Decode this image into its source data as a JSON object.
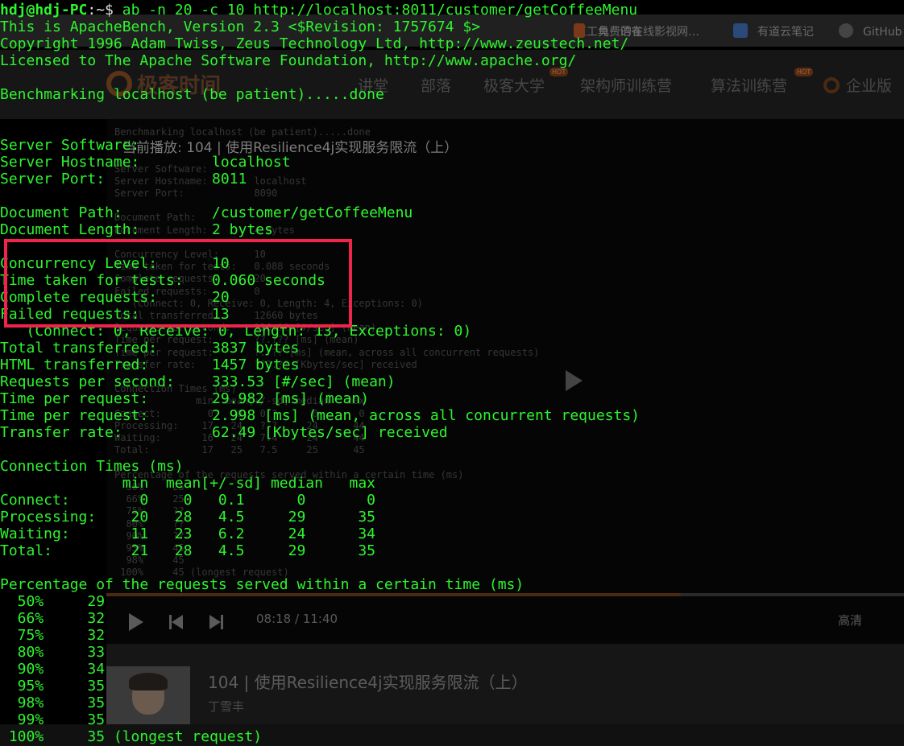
{
  "terminal": {
    "prompt": {
      "user_host": "hdj@hdj-PC",
      "path": ":~$ ",
      "command": "ab -n 20 -c 10 http://localhost:8011/customer/getCoffeeMenu"
    },
    "banner": [
      "This is ApacheBench, Version 2.3 <$Revision: 1757674 $>",
      "Copyright 1996 Adam Twiss, Zeus Technology Ltd, http://www.zeustech.net/",
      "Licensed to The Apache Software Foundation, http://www.apache.org/"
    ],
    "benchmarking": "Benchmarking localhost (be patient).....done",
    "server": [
      {
        "label": "Server Software:",
        "value": ""
      },
      {
        "label": "Server Hostname:",
        "value": "localhost"
      },
      {
        "label": "Server Port:",
        "value": "8011"
      }
    ],
    "document": [
      {
        "label": "Document Path:",
        "value": "/customer/getCoffeeMenu"
      },
      {
        "label": "Document Length:",
        "value": "2 bytes"
      }
    ],
    "highlighted": [
      {
        "label": "Concurrency Level:",
        "value": "10"
      },
      {
        "label": "Time taken for tests:",
        "value": "0.060 seconds"
      },
      {
        "label": "Complete requests:",
        "value": "20"
      },
      {
        "label": "Failed requests:",
        "value": "13"
      }
    ],
    "failed_detail": "   (Connect: 0, Receive: 0, Length: 13, Exceptions: 0)",
    "stats": [
      {
        "label": "Total transferred:",
        "value": "3837 bytes"
      },
      {
        "label": "HTML transferred:",
        "value": "1457 bytes"
      },
      {
        "label": "Requests per second:",
        "value": "333.53 [#/sec] (mean)"
      },
      {
        "label": "Time per request:",
        "value": "29.982 [ms] (mean)"
      },
      {
        "label": "Time per request:",
        "value": "2.998 [ms] (mean, across all concurrent requests)"
      },
      {
        "label": "Transfer rate:",
        "value": "62.49 [Kbytes/sec] received"
      }
    ],
    "connection_times_title": "Connection Times (ms)",
    "connection_times_header": "              min  mean[+/-sd] median   max",
    "connection_times": [
      "Connect:        0    0   0.1      0       0",
      "Processing:    20   28   4.5     29      35",
      "Waiting:       11   23   6.2     24      34",
      "Total:         21   28   4.5     29      35"
    ],
    "percentage_title": "Percentage of the requests served within a certain time (ms)",
    "percentages": [
      "  50%     29",
      "  66%     32",
      "  75%     32",
      "  80%     33",
      "  90%     34",
      "  95%     35",
      "  98%     35",
      "  99%     35",
      " 100%     35 (longest request)"
    ]
  },
  "background": {
    "bookmarks": [
      {
        "label": "有道云笔记",
        "color": "#2b4a7a"
      },
      {
        "label": "GitHub",
        "color": "#444444"
      }
    ],
    "bookmark_partial": [
      "区工具 · 语雀",
      "免费的在线影视网…"
    ],
    "logo": "极客时间",
    "nav": [
      "讲堂",
      "部落",
      "极客大学",
      "架构师训练营",
      "算法训练营",
      "企业版"
    ],
    "hot_badge": "HOT",
    "now_playing": "当前播放: 104 | 使用Resilience4j实现服务限流（上）",
    "video_terminal_lines": [
      "Benchmarking localhost (be patient).....done",
      "",
      "",
      "Server Software:",
      "Server Hostname:        localhost",
      "Server Port:            8090",
      "",
      "Document Path:",
      "Document Length:        4 bytes",
      "",
      "Concurrency Level:      10",
      "Time taken for tests:   0.088 seconds",
      "Complete requests:      20",
      "Failed requests:        0",
      "   (Connect: 0, Receive: 0, Length: 4, Exceptions: 0)",
      "Total transferred:      12660 bytes",
      "Requests per second:    226.?? [#/sec] (mean)",
      "Time per request:       ??.??? [ms] (mean)",
      "Time per request:       ?.??? [ms] (mean, across all concurrent requests)",
      "Transfer rate:          ???.?? [Kbytes/sec] received",
      "",
      "Connection Times (ms)",
      "              min  mean[+/-sd] median   max",
      "Connect:        0    0   0.?      0       0",
      "Processing:    17   24   ?.?     24      44",
      "Waiting:       16   24   7.4     24      44",
      "Total:         17   25   7.5     25      45",
      "",
      "Percentage of the requests served within a certain time (ms)",
      "  50%     25",
      "  66%     25",
      "  75%     ??",
      "  80%     ??",
      "  90%     ??",
      "  95%     45",
      "  98%     45",
      " 100%     45 (longest request)"
    ],
    "time": "08:18 / 11:40",
    "quality": "高清",
    "lesson_title": "104 | 使用Resilience4j实现服务限流（上）",
    "author": "丁雪丰"
  },
  "colors": {
    "terminal_text": "#2ef52e",
    "highlight_box": "#f0244a",
    "background": "#000000"
  }
}
